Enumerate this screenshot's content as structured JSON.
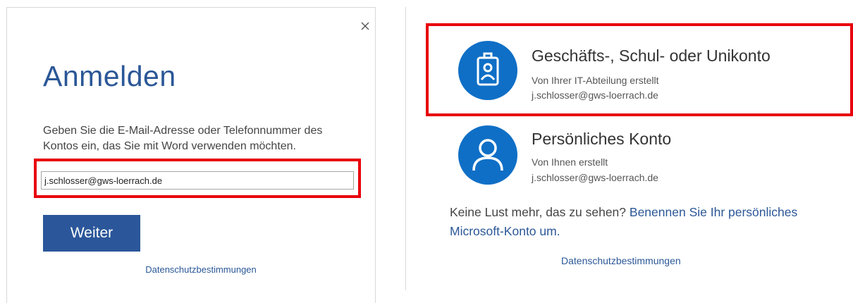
{
  "signin": {
    "title": "Anmelden",
    "instructions": "Geben Sie die E-Mail-Adresse oder Telefonnummer des Kontos ein, das Sie mit Word verwenden möchten.",
    "email_value": "j.schlosser@gws-loerrach.de",
    "next_label": "Weiter",
    "privacy_label": "Datenschutzbestimmungen",
    "close_icon": "close-icon"
  },
  "chooser": {
    "work": {
      "name": "Geschäfts-, Schul- oder Unikonto",
      "created_by": "Von Ihrer IT-Abteilung erstellt",
      "email": "j.schlosser@gws-loerrach.de",
      "icon": "badge-icon"
    },
    "personal": {
      "name": "Persönliches Konto",
      "created_by": "Von Ihnen erstellt",
      "email": "j.schlosser@gws-loerrach.de",
      "icon": "person-icon"
    },
    "prompt_text": "Keine Lust mehr, das zu sehen?",
    "rename_link": "Benennen Sie Ihr persönliches Microsoft-Konto um.",
    "privacy_label": "Datenschutzbestimmungen"
  },
  "colors": {
    "accent": "#2b579a",
    "highlight": "#e8000b",
    "avatar": "#0f6fc6"
  }
}
